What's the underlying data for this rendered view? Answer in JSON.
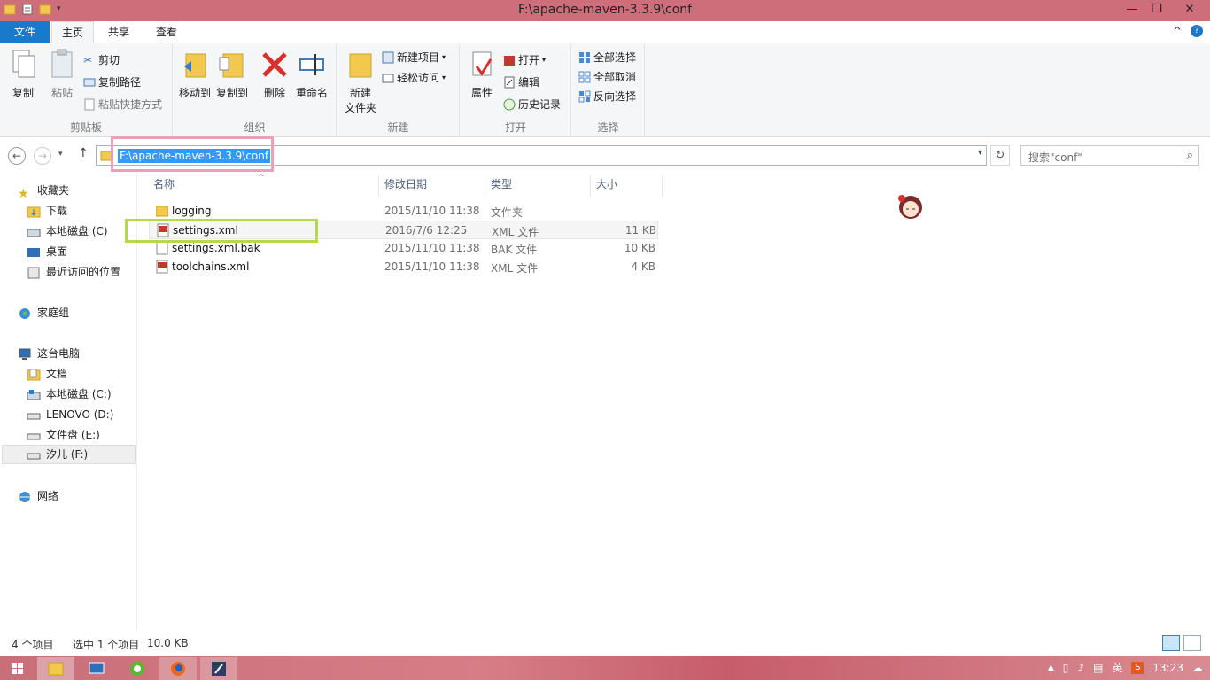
{
  "window": {
    "title": "F:\\apache-maven-3.3.9\\conf",
    "minimize": "—",
    "maximize": "❐",
    "close": "✕"
  },
  "tabs": {
    "file": "文件",
    "home": "主页",
    "share": "共享",
    "view": "查看"
  },
  "ribbon": {
    "clipboard": {
      "label": "剪贴板",
      "copy": "复制",
      "paste": "粘贴",
      "cut": "剪切",
      "copy_path": "复制路径",
      "paste_shortcut": "粘贴快捷方式"
    },
    "organize": {
      "label": "组织",
      "move_to": "移动到",
      "copy_to": "复制到",
      "delete": "删除",
      "rename": "重命名"
    },
    "new": {
      "label": "新建",
      "new_folder_line1": "新建",
      "new_folder_line2": "文件夹",
      "new_item": "新建项目",
      "easy_access": "轻松访问"
    },
    "open": {
      "label": "打开",
      "properties": "属性",
      "open": "打开",
      "edit": "编辑",
      "history": "历史记录"
    },
    "select": {
      "label": "选择",
      "select_all": "全部选择",
      "select_none": "全部取消",
      "invert": "反向选择"
    }
  },
  "address": {
    "path": "F:\\apache-maven-3.3.9\\conf",
    "search_placeholder": "搜索\"conf\""
  },
  "nav": {
    "favorites": "收藏夹",
    "downloads": "下载",
    "local_disk_c_fav": "本地磁盘 (C)",
    "desktop": "桌面",
    "recent": "最近访问的位置",
    "homegroup": "家庭组",
    "this_pc": "这台电脑",
    "documents": "文档",
    "local_disk_c": "本地磁盘 (C:)",
    "lenovo_d": "LENOVO (D:)",
    "file_e": "文件盘 (E:)",
    "xier_f": "汐儿 (F:)",
    "network": "网络"
  },
  "columns": {
    "name": "名称",
    "date": "修改日期",
    "type": "类型",
    "size": "大小"
  },
  "files": [
    {
      "name": "logging",
      "date": "2015/11/10 11:38",
      "type": "文件夹",
      "size": ""
    },
    {
      "name": "settings.xml",
      "date": "2016/7/6 12:25",
      "type": "XML 文件",
      "size": "11 KB"
    },
    {
      "name": "settings.xml.bak",
      "date": "2015/11/10 11:38",
      "type": "BAK 文件",
      "size": "10 KB"
    },
    {
      "name": "toolchains.xml",
      "date": "2015/11/10 11:38",
      "type": "XML 文件",
      "size": "4 KB"
    }
  ],
  "status": {
    "count": "4 个项目",
    "selected": "选中 1 个项目",
    "size": "10.0 KB"
  },
  "tray": {
    "ime": "英",
    "time": "13:23"
  },
  "colors": {
    "accent": "#1979ca",
    "titlebar": "#cf6e7b",
    "selection": "#3399ff",
    "highlight_pink": "#e9a0b8",
    "highlight_green": "#b7d84b"
  }
}
